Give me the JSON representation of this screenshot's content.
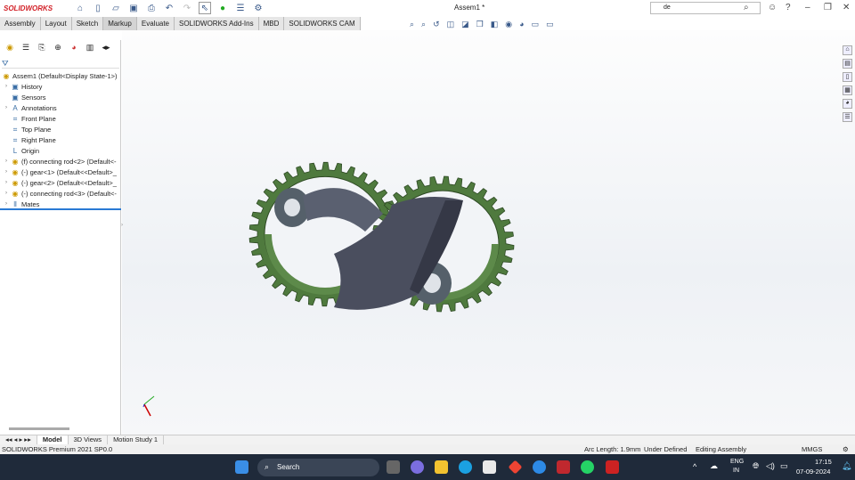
{
  "app": {
    "logo": "SOLIDWORKS",
    "title": "Assem1 *",
    "search_value": "de"
  },
  "command_tabs": [
    "Assembly",
    "Layout",
    "Sketch",
    "Markup",
    "Evaluate",
    "SOLIDWORKS Add-Ins",
    "MBD",
    "SOLIDWORKS CAM"
  ],
  "active_tab": "Markup",
  "tree": {
    "root": "Assem1  (Default<Display State-1>)",
    "items": [
      {
        "label": "History",
        "icon": "history-icon",
        "expand": true
      },
      {
        "label": "Sensors",
        "icon": "sensors-icon",
        "expand": false
      },
      {
        "label": "Annotations",
        "icon": "annotations-icon",
        "expand": true
      },
      {
        "label": "Front Plane",
        "icon": "plane-icon",
        "expand": false
      },
      {
        "label": "Top Plane",
        "icon": "plane-icon",
        "expand": false
      },
      {
        "label": "Right Plane",
        "icon": "plane-icon",
        "expand": false
      },
      {
        "label": "Origin",
        "icon": "origin-icon",
        "expand": false
      },
      {
        "label": "(f) connecting rod<2> (Default<-",
        "icon": "part-icon",
        "expand": true
      },
      {
        "label": "(-) gear<1> (Default<<Default>_",
        "icon": "part-icon",
        "expand": true
      },
      {
        "label": "(-) gear<2> (Default<<Default>_",
        "icon": "part-icon",
        "expand": true
      },
      {
        "label": "(-) connecting rod<3> (Default<-",
        "icon": "part-icon",
        "expand": true
      },
      {
        "label": "Mates",
        "icon": "mates-icon",
        "expand": true
      }
    ]
  },
  "bottom_tabs": [
    "Model",
    "3D Views",
    "Motion Study 1"
  ],
  "status": {
    "product": "SOLIDWORKS Premium 2021 SP0.0",
    "arc_length": "Arc Length: 1.9mm",
    "defined": "Under Defined",
    "mode": "Editing Assembly",
    "units": "MMGS"
  },
  "taskbar": {
    "search": "Search",
    "lang1": "ENG",
    "lang2": "IN",
    "time": "17:15",
    "date": "07-09-2024"
  },
  "colors": {
    "gear": "#4f7a3e",
    "rod": "#4a4e5e",
    "accent": "#d21f26"
  }
}
